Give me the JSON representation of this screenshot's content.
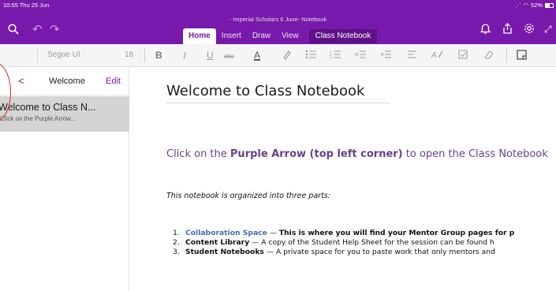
{
  "status": {
    "time_date": "10:55  Thu 25 Jun",
    "battery": "52%"
  },
  "window": {
    "title": "- Imperial Scholars 6 June- Notebook"
  },
  "ribbon": {
    "tabs": [
      "Home",
      "Insert",
      "Draw",
      "View",
      "Class Notebook"
    ],
    "active_tab": "Home"
  },
  "toolbar": {
    "font_name": "Segoe UI",
    "font_size": "18"
  },
  "sidebar": {
    "back_glyph": "<",
    "title": "Welcome",
    "edit_label": "Edit",
    "pages": [
      {
        "title": "Welcome to Class N...",
        "preview": "Click on the Purple Arrow..."
      }
    ]
  },
  "page": {
    "title": "Welcome to Class Notebook",
    "intro_prefix": "Click on the ",
    "intro_bold": "Purple Arrow (top left corner)",
    "intro_suffix": " to open the Class Notebook",
    "organized_note": "This notebook is organized into three parts:",
    "list": [
      {
        "num": "1.",
        "name": "Collaboration Space",
        "dash": " — ",
        "desc": "This is where you will find your Mentor Group pages for p"
      },
      {
        "num": "2.",
        "name": "Content Library",
        "dash": " — ",
        "desc": "A copy of the Student Help Sheet for the session can be found h"
      },
      {
        "num": "3.",
        "name": "Student Notebooks",
        "dash": " — ",
        "desc": "A private space for you to paste work that only mentors and"
      }
    ]
  },
  "colors": {
    "brand_purple": "#7719aa",
    "intro_purple": "#6a3f8c",
    "link_blue": "#3d6fb6",
    "annotation_red": "#d22a2a"
  }
}
